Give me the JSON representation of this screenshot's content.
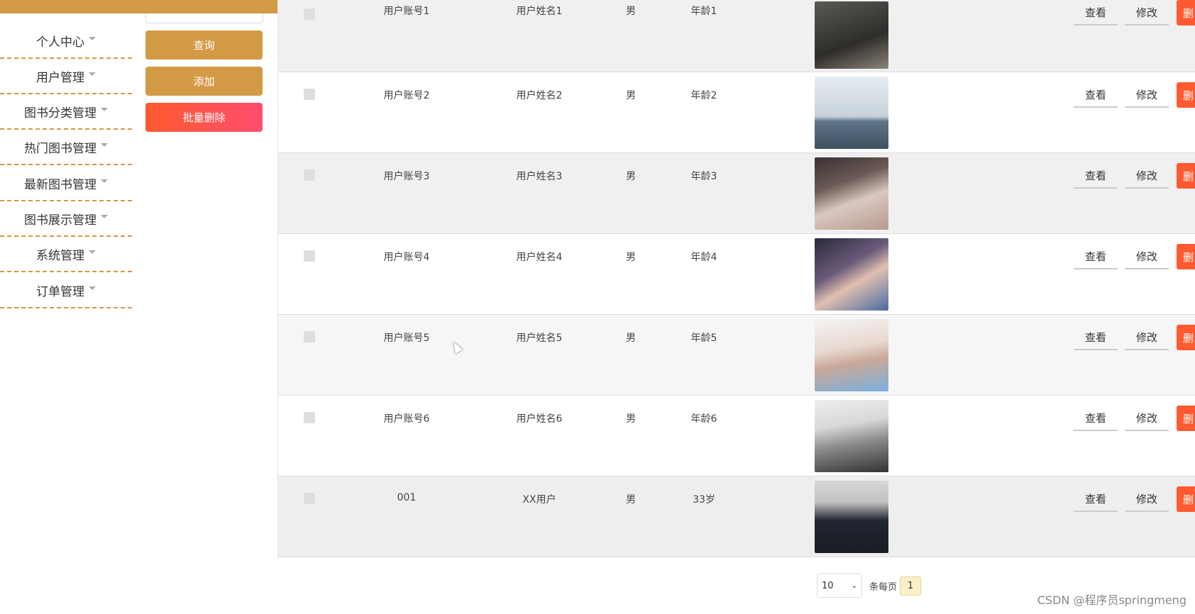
{
  "sidebar": {
    "items": [
      {
        "label": "个人中心"
      },
      {
        "label": "用户管理"
      },
      {
        "label": "图书分类管理"
      },
      {
        "label": "热门图书管理"
      },
      {
        "label": "最新图书管理"
      },
      {
        "label": "图书展示管理"
      },
      {
        "label": "系统管理"
      },
      {
        "label": "订单管理"
      }
    ]
  },
  "actions": {
    "query_label": "查询",
    "add_label": "添加",
    "batch_delete_label": "批量删除"
  },
  "table": {
    "rows": [
      {
        "account": "用户账号1",
        "name": "用户姓名1",
        "gender": "男",
        "age": "年龄1",
        "view": "查看",
        "edit": "修改",
        "delete": "删"
      },
      {
        "account": "用户账号2",
        "name": "用户姓名2",
        "gender": "男",
        "age": "年龄2",
        "view": "查看",
        "edit": "修改",
        "delete": "删"
      },
      {
        "account": "用户账号3",
        "name": "用户姓名3",
        "gender": "男",
        "age": "年龄3",
        "view": "查看",
        "edit": "修改",
        "delete": "删"
      },
      {
        "account": "用户账号4",
        "name": "用户姓名4",
        "gender": "男",
        "age": "年龄4",
        "view": "查看",
        "edit": "修改",
        "delete": "删"
      },
      {
        "account": "用户账号5",
        "name": "用户姓名5",
        "gender": "男",
        "age": "年龄5",
        "view": "查看",
        "edit": "修改",
        "delete": "删"
      },
      {
        "account": "用户账号6",
        "name": "用户姓名6",
        "gender": "男",
        "age": "年龄6",
        "view": "查看",
        "edit": "修改",
        "delete": "删"
      },
      {
        "account": "001",
        "name": "XX用户",
        "gender": "男",
        "age": "33岁",
        "view": "查看",
        "edit": "修改",
        "delete": "删"
      }
    ]
  },
  "pagination": {
    "page_size": "10",
    "per_page_label": "条每页",
    "current_page": "1"
  },
  "watermark": "CSDN @程序员springmeng"
}
